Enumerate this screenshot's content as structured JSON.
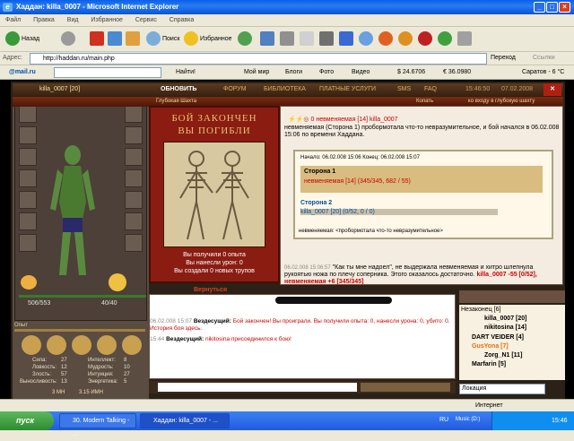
{
  "window": {
    "title": "Хаддан: killa_0007 - Microsoft Internet Explorer"
  },
  "menu": [
    "Файл",
    "Правка",
    "Вид",
    "Избранное",
    "Сервис",
    "Справка"
  ],
  "toolbar": {
    "back": "Назад",
    "search": "Поиск",
    "favorites": "Избранное"
  },
  "address": {
    "label": "Адрес:",
    "url": "http://haddan.ru/main.php",
    "go": "Переход",
    "links": "Ссылки"
  },
  "links": {
    "mailru": "@mail.ru",
    "find": "Найти!",
    "myworld": "Мой мир",
    "blogs": "Блоги",
    "photo": "Фото",
    "video": "Видео",
    "usd": "$ 24.6706",
    "eur": "€ 36.0980",
    "weather": "Саратов - 6 °C"
  },
  "game": {
    "player": "killa_0007 [20]",
    "refresh": "ОБНОВИТЬ",
    "nav": [
      "ФОРУМ",
      "БИБЛИОТЕКА",
      "ПЛАТНЫЕ УСЛУГИ",
      "SMS",
      "FAQ"
    ],
    "time": "15:46:50",
    "date": "07.02.2008",
    "location": "Глубокая Шахта",
    "dig": "Копать",
    "entrance": "ко входу в глубокую шахту",
    "hp": "506/553",
    "mana": "40/40",
    "exp_label": "Опыт",
    "stats": [
      {
        "label": "Сила:",
        "value": "27",
        "label2": "Интеллект:",
        "value2": "8"
      },
      {
        "label": "Ловкость:",
        "value": "12",
        "label2": "Мудрость:",
        "value2": "10"
      },
      {
        "label": "Злость:",
        "value": "57",
        "label2": "Интуиция:",
        "value2": "27"
      },
      {
        "label": "Выносливость:",
        "value": "13",
        "label2": "Энергетика:",
        "value2": "5"
      }
    ],
    "money": "3 МН",
    "money2": "3.15 ИМН",
    "battle": {
      "title1": "БОЙ ЗАКОНЧЕН",
      "title2": "ВЫ ПОГИБЛИ",
      "line1": "Вы получили 0 опыта",
      "line2": "Вы нанесли урон: 0",
      "line3": "Вы создали 0 новых трупов",
      "return": "Вернуться"
    },
    "log": {
      "head": "0  невменяемая [14] killa_0007",
      "p1": "невменяемая (Сторона 1) пробормотала что-то невразумительное, и бой начался в 06.02.008 15:06 по времени Хаддана.",
      "start": "Начало: 06.02.008 15:06 Конец: 06.02.008 15:07",
      "side1": "Сторона 1",
      "side1member": "невменяемая [14] (345/345, 682 / 55)",
      "side2": "Сторона 2",
      "side2member": "killa_0007 [20] (0/52, 0 / 0)",
      "mutter": "невменяемая: <пробормотала что-то невразумительное>",
      "p2a": "06.02.008 15:06:57",
      "p2": "\"Как ты мне надоел\", не выдержала невменяемая и хитро шлепнула рукоятью ножа по плечу соперника. Этого оказалось достаточно.",
      "p2b": "killa_0007 -55 [0/52], невменяемая +6 [345/345]"
    },
    "chat": [
      {
        "time": "06.02.008 15:07",
        "who": "Вездесущий:",
        "text": "Бой закончен! Вы проиграли. Вы получили опыта: 0, нанесли урона: 0, убито: 0. История боя здесь."
      },
      {
        "time": "15:44",
        "who": "Вездесущий:",
        "text": "nikitosina присоединился к бою!"
      }
    ],
    "panel_title": "Незаконец [6]",
    "players": [
      "killa_0007 [20]",
      "nikitosina [14]",
      "DART VEIDER [4]",
      "GusYona [7]",
      "Zorg_N1 [11]",
      "Marfarin [5]"
    ],
    "location_select": "Локация"
  },
  "status": {
    "zone": "Интернет"
  },
  "taskbar": {
    "start": "пуск",
    "task1": "30. Modern Talking - ...",
    "task2": "Хаддан: killa_0007 - ...",
    "lang": "RU",
    "disk": "Music (D:)",
    "clock": "15:46"
  },
  "colors": {
    "titlebar": "#0a5fe8",
    "taskbar": "#225ae0",
    "battle_red": "#8a1c12"
  }
}
